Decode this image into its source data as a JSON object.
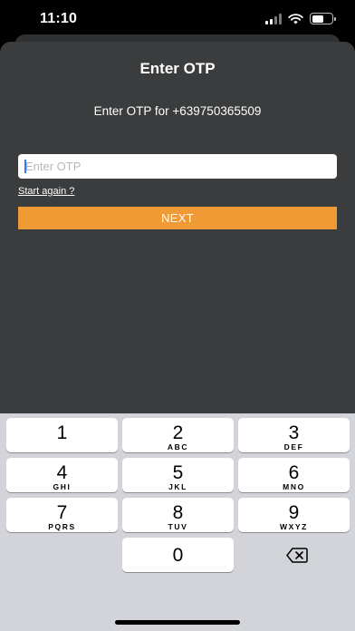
{
  "status_bar": {
    "time": "11:10"
  },
  "screen": {
    "title": "Enter OTP",
    "subtitle": "Enter OTP for +639750365509",
    "otp_input": {
      "value": "",
      "placeholder": "Enter OTP"
    },
    "start_again_link": "Start again ?",
    "next_button": "NEXT",
    "accent_color": "#f09a36"
  },
  "keyboard": {
    "keys": [
      {
        "digit": "1",
        "letters": ""
      },
      {
        "digit": "2",
        "letters": "ABC"
      },
      {
        "digit": "3",
        "letters": "DEF"
      },
      {
        "digit": "4",
        "letters": "GHI"
      },
      {
        "digit": "5",
        "letters": "JKL"
      },
      {
        "digit": "6",
        "letters": "MNO"
      },
      {
        "digit": "7",
        "letters": "PQRS"
      },
      {
        "digit": "8",
        "letters": "TUV"
      },
      {
        "digit": "9",
        "letters": "WXYZ"
      },
      {
        "digit": "0",
        "letters": ""
      }
    ],
    "delete_icon": "backspace-icon"
  }
}
